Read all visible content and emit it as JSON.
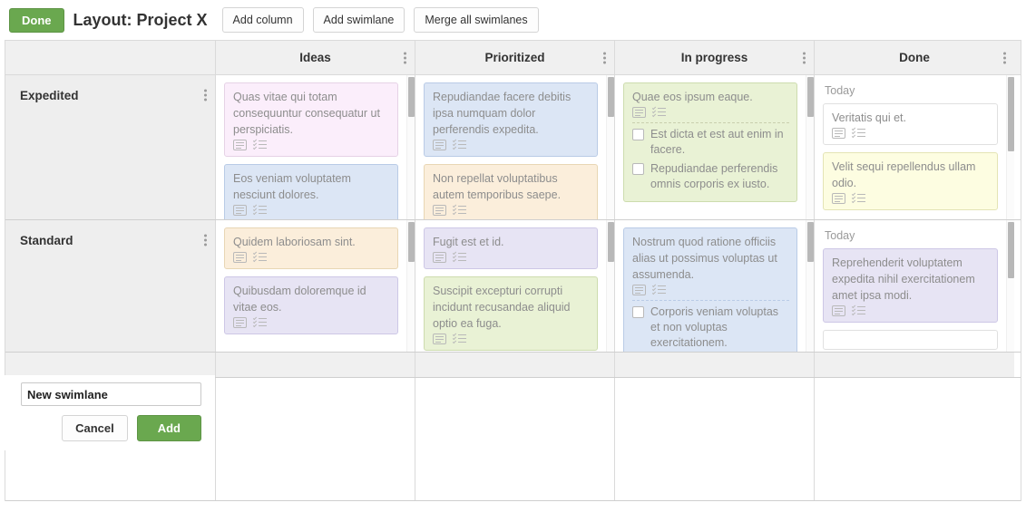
{
  "toolbar": {
    "done_label": "Done",
    "title": "Layout: Project X",
    "add_column_label": "Add column",
    "add_swimlane_label": "Add swimlane",
    "merge_label": "Merge all swimlanes"
  },
  "columns": [
    {
      "title": "Ideas"
    },
    {
      "title": "Prioritized"
    },
    {
      "title": "In progress"
    },
    {
      "title": "Done"
    }
  ],
  "swimlanes": [
    {
      "title": "Expedited"
    },
    {
      "title": "Standard"
    }
  ],
  "cards": {
    "expedited": {
      "ideas": [
        {
          "text": "Quas vitae qui totam consequuntur consequatur ut perspiciatis.",
          "color": "#fbeefb",
          "border": "#e6d2e6"
        },
        {
          "text": "Eos veniam voluptatem nesciunt dolores.",
          "color": "#dce6f5",
          "border": "#b9cbe6"
        }
      ],
      "prioritized": [
        {
          "text": "Repudiandae facere debitis ipsa numquam dolor perferendis expedita.",
          "color": "#dce6f5",
          "border": "#b9cbe6"
        },
        {
          "text": "Non repellat voluptatibus autem temporibus saepe.",
          "color": "#fbeedb",
          "border": "#e8d6b4"
        }
      ],
      "in_progress": [
        {
          "text": "Quae eos ipsum eaque.",
          "color": "#e9f2d5",
          "border": "#cddcae",
          "subtasks": [
            "Est dicta et est aut enim in facere.",
            "Repudiandae perferendis omnis corporis ex iusto."
          ]
        }
      ],
      "done": {
        "group_label": "Today",
        "items": [
          {
            "text": "Veritatis qui et.",
            "color": "#ffffff",
            "border": "#e0e0e0"
          },
          {
            "text": "Velit sequi repellendus ullam odio.",
            "color": "#fdfde1",
            "border": "#e4e4b5"
          }
        ]
      }
    },
    "standard": {
      "ideas": [
        {
          "text": "Quidem laboriosam sint.",
          "color": "#fbeedb",
          "border": "#e8d6b4"
        },
        {
          "text": "Quibusdam doloremque id vitae eos.",
          "color": "#e7e4f4",
          "border": "#cdc7e6"
        }
      ],
      "prioritized": [
        {
          "text": "Fugit est et id.",
          "color": "#e7e4f4",
          "border": "#cdc7e6"
        },
        {
          "text": "Suscipit excepturi corrupti incidunt recusandae aliquid optio ea fuga.",
          "color": "#e9f2d5",
          "border": "#cddcae"
        }
      ],
      "in_progress": [
        {
          "text": "Nostrum quod ratione officiis alias ut possimus voluptas ut assumenda.",
          "color": "#dce6f5",
          "border": "#b9cbe6",
          "subtasks": [
            "Corporis veniam voluptas et non voluptas exercitationem."
          ]
        }
      ],
      "done": {
        "group_label": "Today",
        "items": [
          {
            "text": "Reprehenderit voluptatem expedita nihil exercitationem amet ipsa modi.",
            "color": "#e7e4f4",
            "border": "#cdc7e6"
          }
        ]
      }
    }
  },
  "new_swimlane_form": {
    "value": "New swimlane",
    "cancel_label": "Cancel",
    "add_label": "Add"
  }
}
